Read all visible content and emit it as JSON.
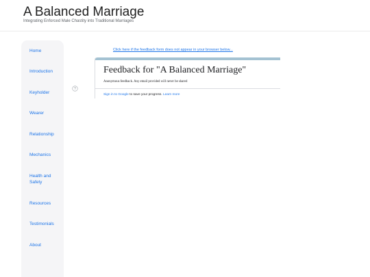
{
  "header": {
    "title": "A Balanced Marriage",
    "tagline": "Integrating Enforced Male Chastity into Traditional Marriages"
  },
  "sidebar": {
    "items": [
      {
        "label": "Home"
      },
      {
        "label": "Introduction"
      },
      {
        "label": "Keyholder"
      },
      {
        "label": "Wearer"
      },
      {
        "label": "Relationship"
      },
      {
        "label": "Mechanics"
      },
      {
        "label": "Health and Safety"
      },
      {
        "label": "Resources"
      },
      {
        "label": "Testimonials"
      },
      {
        "label": "About"
      }
    ]
  },
  "main": {
    "fallback_link": "Click here if the feedback form does not appear in your browser below...",
    "help_icon": "question-circle-icon",
    "form": {
      "title": "Feedback for \"A Balanced Marriage\"",
      "description": "Anonymous feedback.  Any email provided will never be shared",
      "signin_link": "Sign in to Google",
      "signin_text": " to save your progress. ",
      "learn_more": "Learn more",
      "accent_color": "#a4c2d2"
    }
  },
  "colors": {
    "link": "#1a73e8",
    "sidebar_bg": "#f5f5f7",
    "title_text": "#212121"
  }
}
